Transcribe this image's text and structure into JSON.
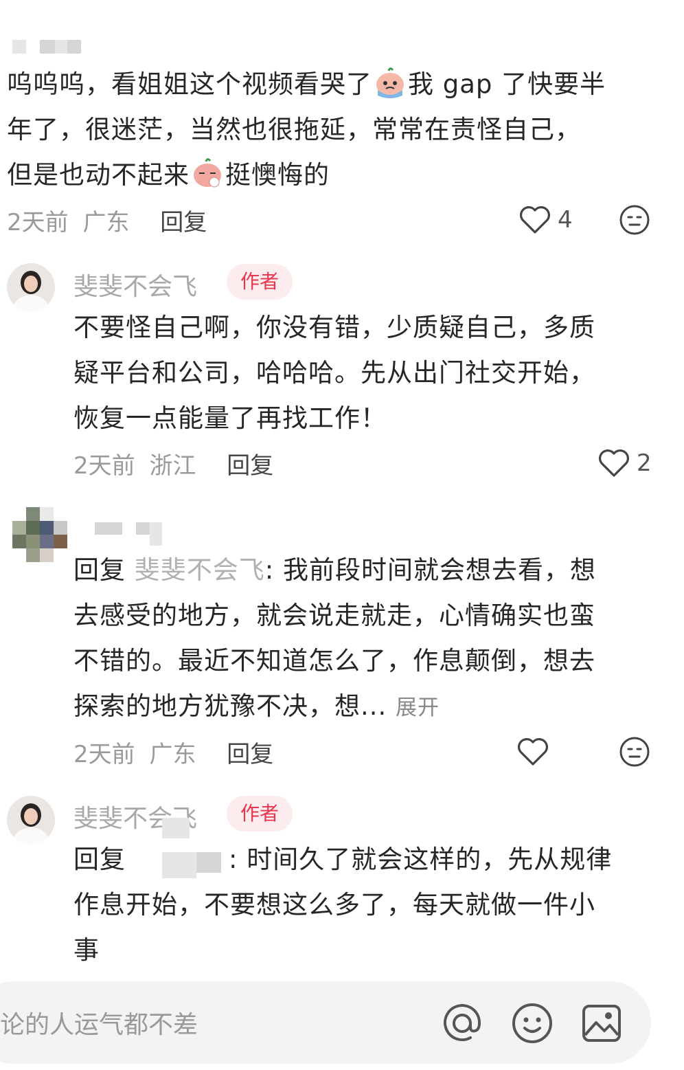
{
  "comments": [
    {
      "text_lines": [
        "呜呜呜，看姐姐这个视频看哭了",
        "我 gap 了快要半",
        "年了，很迷茫，当然也很拖延，常常在责怪自己，",
        "但是也动不起来",
        "挺懊悔的"
      ],
      "time": "2天前",
      "location": "广东",
      "reply_label": "回复",
      "likes": "4"
    },
    {
      "username": "斐斐不会飞",
      "tag": "作者",
      "text_lines": [
        "不要怪自己啊，你没有错，少质疑自己，多质",
        "疑平台和公司，哈哈哈。先从出门社交开始，",
        "恢复一点能量了再找工作！"
      ],
      "time": "2天前",
      "location": "浙江",
      "reply_label": "回复",
      "likes": "2"
    },
    {
      "reply_prefix": "回复",
      "reply_to": "斐斐不会飞",
      "text_lines": [
        ": 我前段时间就会想去看，想",
        "去感受的地方，就会说走就走，心情确实也蛮",
        "不错的。最近不知道怎么了，作息颠倒，想去",
        "探索的地方犹豫不决，想..."
      ],
      "expand_label": "展开",
      "time": "2天前",
      "location": "广东",
      "reply_label": "回复"
    },
    {
      "username": "斐斐不会飞",
      "tag": "作者",
      "reply_prefix": "回复",
      "text_lines": [
        ": 时间久了就会这样的，先从规律",
        "作息开始，不要想这么多了，每天就做一件小",
        "事"
      ]
    }
  ],
  "input": {
    "placeholder": "论的人运气都不差"
  },
  "colors": {
    "author_tag_bg": "#fdecee",
    "author_tag_text": "#e8344d"
  }
}
